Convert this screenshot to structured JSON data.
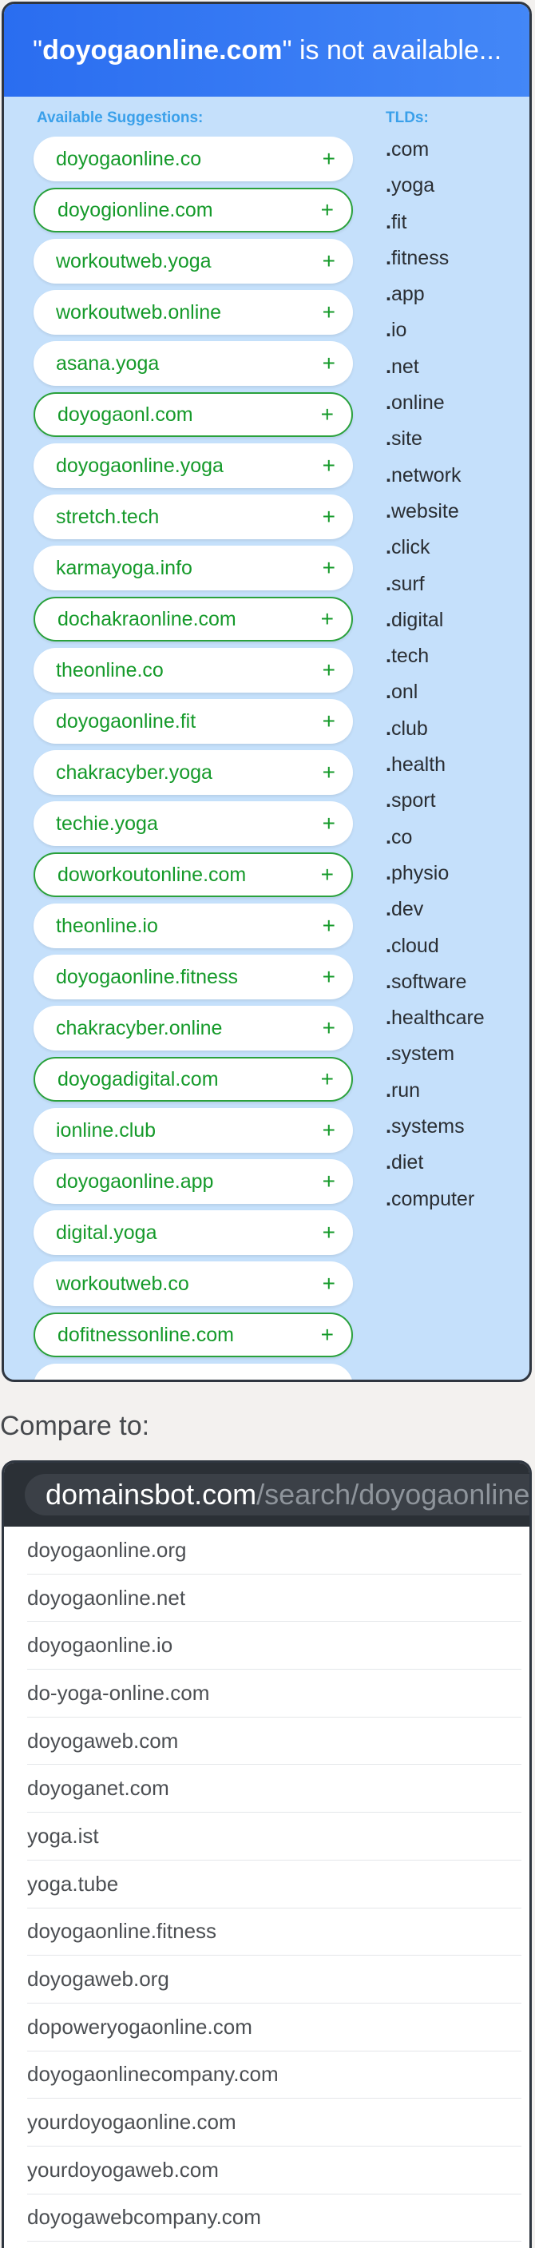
{
  "header": {
    "quote_open": "\"",
    "domain": "doyogaonline.com",
    "quote_close": "\"",
    "rest": " is not available..."
  },
  "suggestions_label": "Available Suggestions:",
  "tlds_label": "TLDs:",
  "suggestions": [
    {
      "name": "doyogaonline.co",
      "outlined": false
    },
    {
      "name": "doyogionline.com",
      "outlined": true
    },
    {
      "name": "workoutweb.yoga",
      "outlined": false
    },
    {
      "name": "workoutweb.online",
      "outlined": false
    },
    {
      "name": "asana.yoga",
      "outlined": false
    },
    {
      "name": "doyogaonl.com",
      "outlined": true
    },
    {
      "name": "doyogaonline.yoga",
      "outlined": false
    },
    {
      "name": "stretch.tech",
      "outlined": false
    },
    {
      "name": "karmayoga.info",
      "outlined": false
    },
    {
      "name": "dochakraonline.com",
      "outlined": true
    },
    {
      "name": "theonline.co",
      "outlined": false
    },
    {
      "name": "doyogaonline.fit",
      "outlined": false
    },
    {
      "name": "chakracyber.yoga",
      "outlined": false
    },
    {
      "name": "techie.yoga",
      "outlined": false
    },
    {
      "name": "doworkoutonline.com",
      "outlined": true
    },
    {
      "name": "theonline.io",
      "outlined": false
    },
    {
      "name": "doyogaonline.fitness",
      "outlined": false
    },
    {
      "name": "chakracyber.online",
      "outlined": false
    },
    {
      "name": "doyogadigital.com",
      "outlined": true
    },
    {
      "name": "ionline.club",
      "outlined": false
    },
    {
      "name": "doyogaonline.app",
      "outlined": false
    },
    {
      "name": "digital.yoga",
      "outlined": false
    },
    {
      "name": "workoutweb.co",
      "outlined": false
    },
    {
      "name": "dofitnessonline.com",
      "outlined": true
    },
    {
      "name": "",
      "outlined": false
    }
  ],
  "plus_symbol": "+",
  "tlds": [
    "com",
    "yoga",
    "fit",
    "fitness",
    "app",
    "io",
    "net",
    "online",
    "site",
    "network",
    "website",
    "click",
    "surf",
    "digital",
    "tech",
    "onl",
    "club",
    "health",
    "sport",
    "co",
    "physio",
    "dev",
    "cloud",
    "software",
    "healthcare",
    "system",
    "run",
    "systems",
    "diet",
    "computer"
  ],
  "compare_label": "Compare to:",
  "compare_url": {
    "domain": "domainsbot.com",
    "path": "/search/doyogaonline"
  },
  "compare_results": [
    "doyogaonline.org",
    "doyogaonline.net",
    "doyogaonline.io",
    "do-yoga-online.com",
    "doyogaweb.com",
    "doyoganet.com",
    "yoga.ist",
    "yoga.tube",
    "doyogaonline.fitness",
    "doyogaweb.org",
    "dopoweryogaonline.com",
    "doyogaonlinecompany.com",
    "yourdoyogaonline.com",
    "yourdoyogaweb.com",
    "doyogawebcompany.com"
  ],
  "colors": {
    "accent_blue": "#2a6df0",
    "suggestion_green": "#159a2a",
    "panel_bg": "#c5e0fb"
  }
}
